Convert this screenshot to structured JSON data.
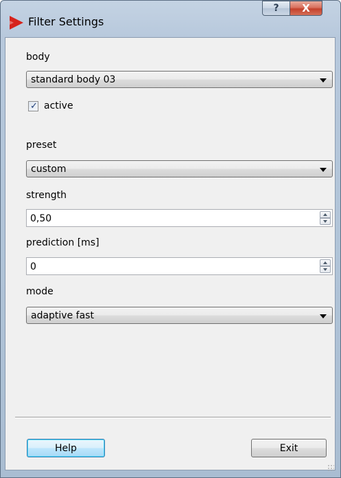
{
  "window": {
    "title": "Filter Settings",
    "help_glyph": "?",
    "close_glyph": "X"
  },
  "body": {
    "label": "body",
    "selected": "standard body 03",
    "active_label": "active",
    "active_checked": true
  },
  "preset": {
    "label": "preset",
    "selected": "custom"
  },
  "strength": {
    "label": "strength",
    "value": "0,50"
  },
  "prediction": {
    "label": "prediction [ms]",
    "value": "0"
  },
  "mode": {
    "label": "mode",
    "selected": "adaptive fast"
  },
  "buttons": {
    "help": "Help",
    "exit": "Exit"
  },
  "colors": {
    "titlebar": "#b7c8dc",
    "client_bg": "#f0f0f0",
    "app_icon": "#d6231c",
    "close_button": "#c4412c",
    "default_button": "#bee6fd"
  },
  "icons": {
    "app": "red-play-triangle-icon",
    "help": "question-mark-icon",
    "close": "close-x-icon",
    "dropdown": "chevron-down-icon",
    "spinner": "spin-up-down-icon",
    "check": "checkmark-icon"
  }
}
